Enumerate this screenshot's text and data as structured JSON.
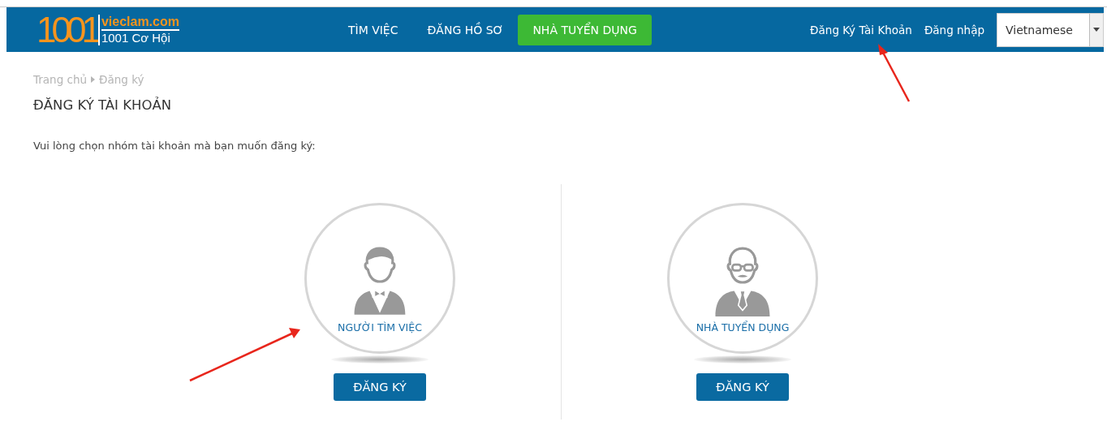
{
  "header": {
    "logo": {
      "mark": "1001",
      "domain": "vieclam.com",
      "tagline": "1001 Cơ Hội"
    },
    "nav": [
      {
        "label": "TÌM VIỆC",
        "selected": false
      },
      {
        "label": "ĐĂNG HỒ SƠ",
        "selected": false
      },
      {
        "label": "NHÀ TUYỂN DỤNG",
        "selected": true
      }
    ],
    "links": [
      "Đăng Ký Tài Khoản",
      "Đăng nhập"
    ],
    "language": {
      "value": "Vietnamese"
    }
  },
  "breadcrumb": [
    "Trang chủ",
    "Đăng ký"
  ],
  "title": "ĐĂNG KÝ TÀI KHOẢN",
  "instruction": "Vui lòng chọn nhóm tài khoản mà bạn muốn đăng ký:",
  "account_types": [
    {
      "kind": "young",
      "label": "NGƯỜI TÌM VIỆC",
      "button": "ĐĂNG KÝ"
    },
    {
      "kind": "elder",
      "label": "NHÀ TUYỂN DỤNG",
      "button": "ĐĂNG KÝ"
    }
  ]
}
